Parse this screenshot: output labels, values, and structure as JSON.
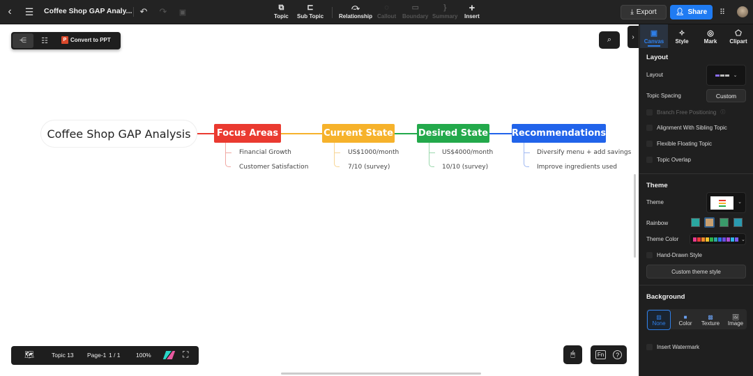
{
  "header": {
    "title": "Coffee Shop GAP Analy...",
    "tools": [
      {
        "label": "Topic",
        "icon": "topic-icon"
      },
      {
        "label": "Sub Topic",
        "icon": "subtopic-icon"
      },
      {
        "label": "Relationship",
        "icon": "relationship-icon"
      },
      {
        "label": "Callout",
        "icon": "callout-icon"
      },
      {
        "label": "Boundary",
        "icon": "boundary-icon"
      },
      {
        "label": "Summary",
        "icon": "summary-icon"
      },
      {
        "label": "Insert",
        "icon": "plus-icon"
      }
    ],
    "export_label": "Export",
    "share_label": "Share"
  },
  "floatbar": {
    "convert_label": "Convert to PPT",
    "ppt_badge": "P"
  },
  "mindmap": {
    "root": "Coffee Shop GAP Analysis",
    "branches": [
      {
        "title": "Focus Areas",
        "color": "#ea3a30",
        "children": [
          "Financial Growth",
          "Customer Satisfaction"
        ]
      },
      {
        "title": "Current State",
        "color": "#f6b22b",
        "children": [
          "US$1000/month",
          "7/10 (survey)"
        ]
      },
      {
        "title": "Desired State",
        "color": "#23a94b",
        "children": [
          "US$4000/month",
          "10/10 (survey)"
        ]
      },
      {
        "title": "Recommendations",
        "color": "#2163ea",
        "children": [
          "Diversify menu + add savings",
          "Improve ingredients used"
        ]
      }
    ]
  },
  "panel": {
    "tabs": [
      "Canvas",
      "Style",
      "Mark",
      "Clipart"
    ],
    "layout_heading": "Layout",
    "layout_label": "Layout",
    "topic_spacing_label": "Topic Spacing",
    "custom_label": "Custom",
    "checks": [
      "Branch Free Positioning",
      "Alignment With Sibling Topic",
      "Flexible Floating Topic",
      "Topic Overlap"
    ],
    "theme_heading": "Theme",
    "theme_label": "Theme",
    "rainbow_label": "Rainbow",
    "theme_color_label": "Theme Color",
    "hand_drawn_label": "Hand-Drawn Style",
    "custom_theme_label": "Custom theme style",
    "background_heading": "Background",
    "bg_options": [
      "None",
      "Color",
      "Texture",
      "Image"
    ],
    "watermark_label": "Insert Watermark",
    "theme_colors": [
      "#e83a8c",
      "#ef3b3b",
      "#f58a2a",
      "#f2c12e",
      "#2fb34a",
      "#2aa7a0",
      "#2f6fea",
      "#6a4de0",
      "#b04fd6",
      "#2fb3e8",
      "#7a5cf0"
    ]
  },
  "bottombar": {
    "topic_count": "Topic 13",
    "page": "Page-1",
    "page_count": "1 / 1",
    "zoom": "100%"
  }
}
